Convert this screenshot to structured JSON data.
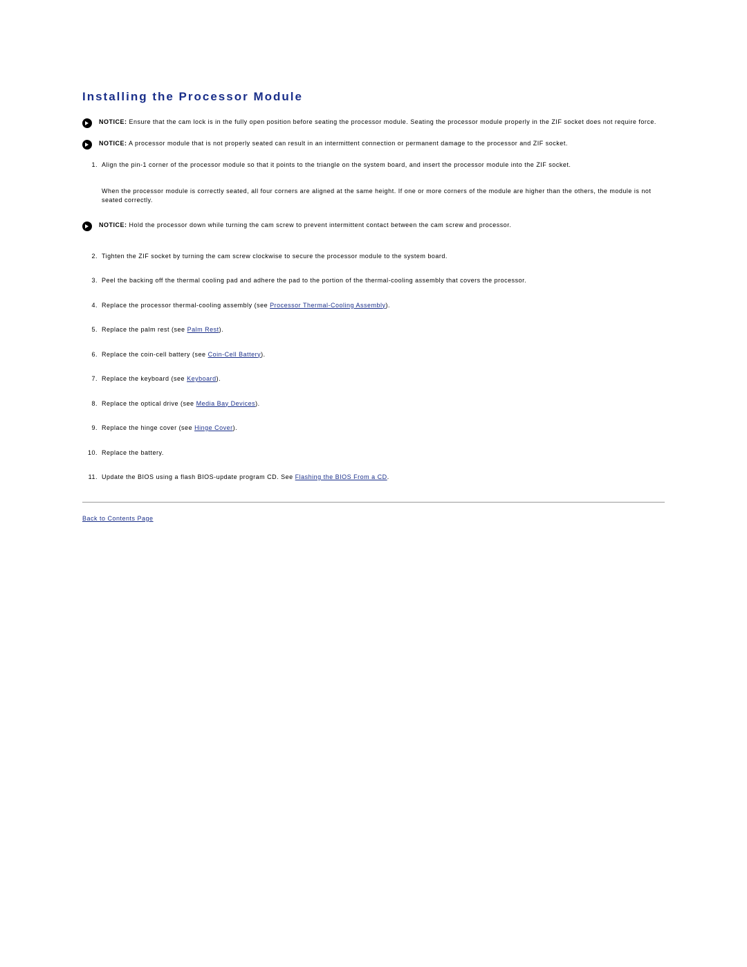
{
  "heading": "Installing the Processor Module",
  "notice_label": "NOTICE:",
  "notices": {
    "n1": "Ensure that the cam lock is in the fully open position before seating the processor module. Seating the processor module properly in the ZIF socket does not require force.",
    "n2": "A processor module that is not properly seated can result in an intermittent connection or permanent damage to the processor and ZIF socket.",
    "n3": "Hold the processor down while turning the cam screw to prevent intermittent contact between the cam screw and processor."
  },
  "steps": {
    "s1": "Align the pin-1 corner of the processor module so that it points to the triangle on the system board, and insert the processor module into the ZIF socket.",
    "s1b": "When the processor module is correctly seated, all four corners are aligned at the same height. If one or more corners of the module are higher than the others, the module is not seated correctly.",
    "s2": "Tighten the ZIF socket by turning the cam screw clockwise to secure the processor module to the system board.",
    "s3": "Peel the backing off the thermal cooling pad and adhere the pad to the portion of the thermal-cooling assembly that covers the processor.",
    "s4a": "Replace the processor thermal-cooling assembly (see ",
    "s4link": "Processor Thermal-Cooling Assembly",
    "s4b": ").",
    "s5a": "Replace the palm rest (see ",
    "s5link": "Palm Rest",
    "s5b": ").",
    "s6a": "Replace the coin-cell battery (see ",
    "s6link": "Coin-Cell Battery",
    "s6b": ").",
    "s7a": "Replace the keyboard (see ",
    "s7link": "Keyboard",
    "s7b": ").",
    "s8a": "Replace the optical drive (see ",
    "s8link": "Media Bay Devices",
    "s8b": ").",
    "s9a": "Replace the hinge cover (see ",
    "s9link": "Hinge Cover",
    "s9b": ").",
    "s10": "Replace the battery.",
    "s11a": "Update the BIOS using a flash BIOS-update program CD. See ",
    "s11link": "Flashing the BIOS From a CD",
    "s11b": "."
  },
  "back_link": "Back to Contents Page"
}
